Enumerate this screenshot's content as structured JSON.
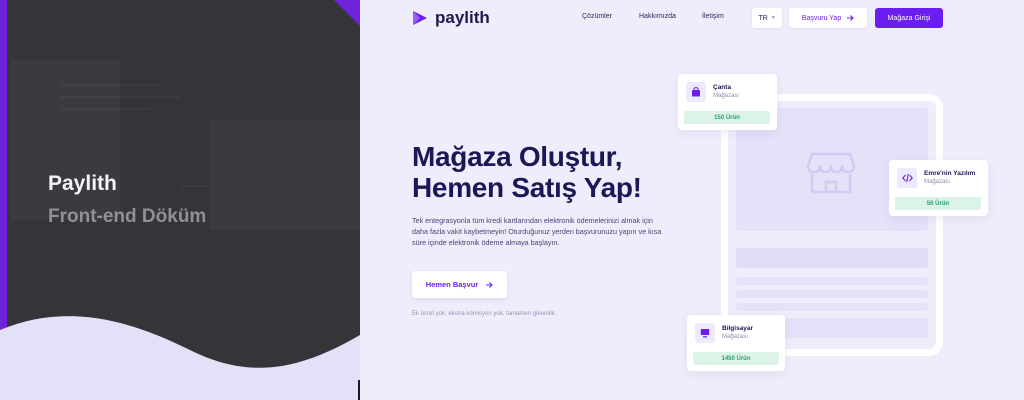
{
  "left_panel": {
    "title": "Paylith",
    "subtitle": "Front-end Döküm"
  },
  "nav": {
    "brand": "paylith",
    "links": [
      "Çözümler",
      "Hakkımızda",
      "İletişim"
    ],
    "language": "TR",
    "apply_label": "Başvuru Yap",
    "login_label": "Mağaza Girişi"
  },
  "hero": {
    "title_line1": "Mağaza Oluştur,",
    "title_line2": "Hemen Satış Yap!",
    "description": "Tek entegrasyonla tüm kredi kartlarından elektronik ödemelerinizi almak için daha fazla vakit kaybetmeyin! Oturduğunuz yerden başvurunuzu yapın ve kısa süre içinde elektronik ödeme almaya başlayın.",
    "cta_label": "Hemen Başvur",
    "note": "Ek ücret yok, ekstra komisyon yok, tamamen güvenilir."
  },
  "cards": [
    {
      "name": "Çanta",
      "type": "Mağazası",
      "count": "150 Ürün",
      "icon": "bag-icon"
    },
    {
      "name": "Emre'nin Yazılım",
      "type": "Mağazası",
      "count": "50 Ürün",
      "icon": "code-icon"
    },
    {
      "name": "Bilgisayar",
      "type": "Mağazası",
      "count": "1450 Ürün",
      "icon": "monitor-icon"
    }
  ],
  "colors": {
    "primary": "#6c1ef0",
    "navy": "#1e1755",
    "background": "#eeedfb",
    "dark_panel": "#353438",
    "success": "#23a46a"
  }
}
